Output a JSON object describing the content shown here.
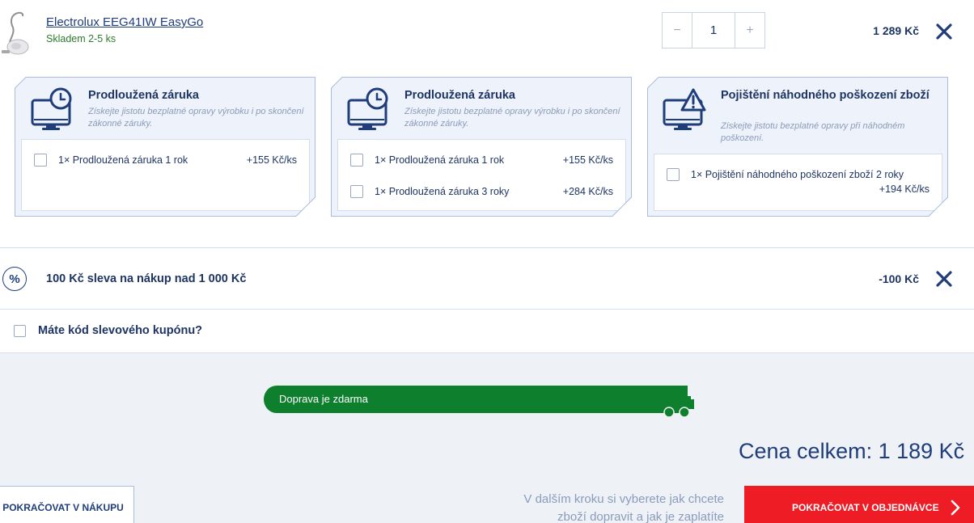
{
  "product": {
    "name": "Electrolux EEG41IW EasyGo",
    "stock": "Skladem 2-5 ks",
    "quantity": "1",
    "qty_minus": "−",
    "qty_plus": "+",
    "price": "1 289 Kč",
    "remove_icon": "close-icon"
  },
  "cards": [
    {
      "icon": "monitor-clock-icon",
      "title": "Prodloužená záruka",
      "description": "Získejte jistotu bezplatné opravy výrobku i po skončení zákonné záruky.",
      "options": [
        {
          "label": "1× Prodloužená záruka 1 rok",
          "price": "+155 Kč/ks"
        }
      ]
    },
    {
      "icon": "monitor-clock-icon",
      "title": "Prodloužená záruka",
      "description": "Získejte jistotu bezplatné opravy výrobku i po skončení zákonné záruky.",
      "options": [
        {
          "label": "1× Prodloužená záruka 1 rok",
          "price": "+155 Kč/ks"
        },
        {
          "label": "1× Prodloužená záruka 3 roky",
          "price": "+284 Kč/ks"
        }
      ]
    },
    {
      "icon": "monitor-warning-icon",
      "title": "Pojištění náhodného poškození zboží",
      "description": "Získejte jistotu bezplatné opravy při náhodném poškození.",
      "options": [
        {
          "label": "1× Pojištění náhodného poškození zboží 2 roky",
          "price": "+194 Kč/ks"
        }
      ]
    }
  ],
  "discount": {
    "icon_symbol": "%",
    "label": "100 Kč sleva na nákup nad 1 000 Kč",
    "value": "-100 Kč"
  },
  "coupon": {
    "label": "Máte kód slevového kupónu?"
  },
  "shipping": {
    "label": "Doprava je zdarma",
    "bar_color": "#0e7f2d"
  },
  "summary": {
    "total": "Cena celkem: 1 189 Kč",
    "note_line1": "V dalším kroku si vyberete jak chcete",
    "note_line2": "zboží dopravit a jak je zaplatíte",
    "back_button": "POKRAČOVAT V NÁKUPU",
    "next_button": "POKRAČOVAT V OBJEDNÁVCE",
    "next_color": "#ee1c25"
  }
}
